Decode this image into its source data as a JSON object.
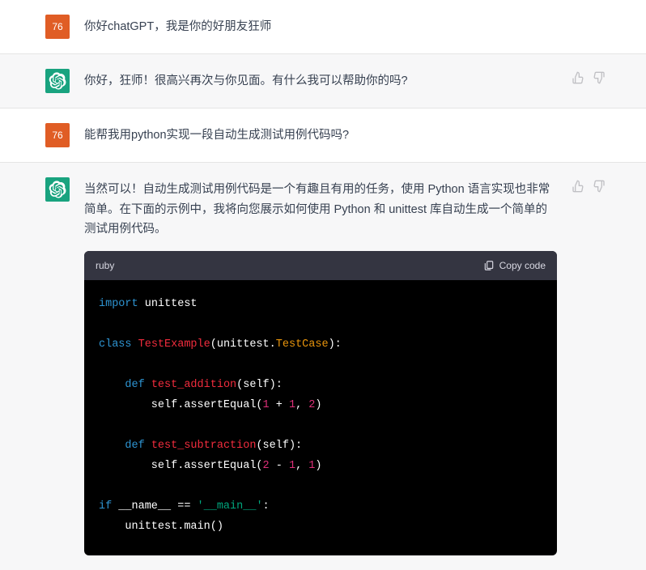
{
  "user_avatar_label": "76",
  "messages": {
    "m1": {
      "role": "user",
      "text": "你好chatGPT，我是你的好朋友狂师"
    },
    "m2": {
      "role": "assistant",
      "text": "你好，狂师！很高兴再次与你见面。有什么我可以帮助你的吗?"
    },
    "m3": {
      "role": "user",
      "text": "能帮我用python实现一段自动生成测试用例代码吗?"
    },
    "m4": {
      "role": "assistant",
      "text": "当然可以！自动生成测试用例代码是一个有趣且有用的任务，使用 Python 语言实现也非常简单。在下面的示例中，我将向您展示如何使用 Python 和 unittest 库自动生成一个简单的测试用例代码。"
    }
  },
  "code_block": {
    "language_label": "ruby",
    "copy_label": "Copy code",
    "tokens": {
      "kw_import": "import",
      "mod_unittest": "unittest",
      "kw_class": "class",
      "cls_testexample": "TestExample",
      "cls_testcase": "TestCase",
      "kw_def1": "def",
      "fn_test_addition": "test_addition",
      "kw_def2": "def",
      "fn_test_subtraction": "test_subtraction",
      "self1": "(self):",
      "self2": "(self):",
      "assert1_pre": "        self.assertEqual(",
      "assert2_pre": "        self.assertEqual(",
      "n1": "1",
      "n1b": "1",
      "n2": "2",
      "n2b": "2",
      "n1c": "1",
      "n1d": "1",
      "plus": " + ",
      "minus": " - ",
      "comma": ", ",
      "comma2": ", ",
      "close": ")",
      "close2": ")",
      "kw_if": "if",
      "dunder_name": " __name__ == ",
      "str_main": "'__main__'",
      "colon": ":",
      "main_call": "    unittest.main()",
      "lparen_unittest": "(unittest.",
      "rparen_colon": "):"
    }
  }
}
